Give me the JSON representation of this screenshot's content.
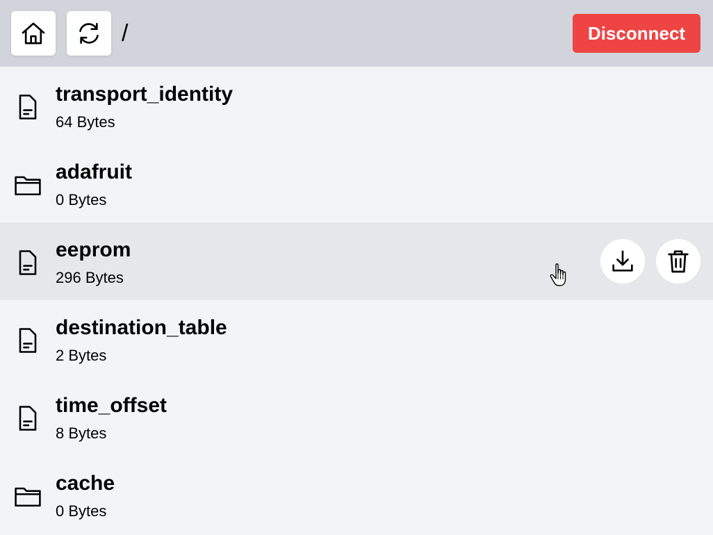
{
  "toolbar": {
    "home_icon": "home-icon",
    "refresh_icon": "refresh-icon",
    "path": "/",
    "disconnect_label": "Disconnect",
    "disconnect_color": "#ef4444"
  },
  "files": [
    {
      "name": "transport_identity",
      "size": "64 Bytes",
      "type": "file"
    },
    {
      "name": "adafruit",
      "size": "0 Bytes",
      "type": "folder"
    },
    {
      "name": "eeprom",
      "size": "296 Bytes",
      "type": "file",
      "hovered": true
    },
    {
      "name": "destination_table",
      "size": "2 Bytes",
      "type": "file"
    },
    {
      "name": "time_offset",
      "size": "8 Bytes",
      "type": "file"
    },
    {
      "name": "cache",
      "size": "0 Bytes",
      "type": "folder"
    }
  ],
  "row_actions": {
    "download_icon": "download-icon",
    "delete_icon": "trash-icon"
  },
  "colors": {
    "toolbar_bg": "#d1d5db",
    "list_bg": "#f3f4f6",
    "hover_row_bg": "#e5e7eb"
  }
}
